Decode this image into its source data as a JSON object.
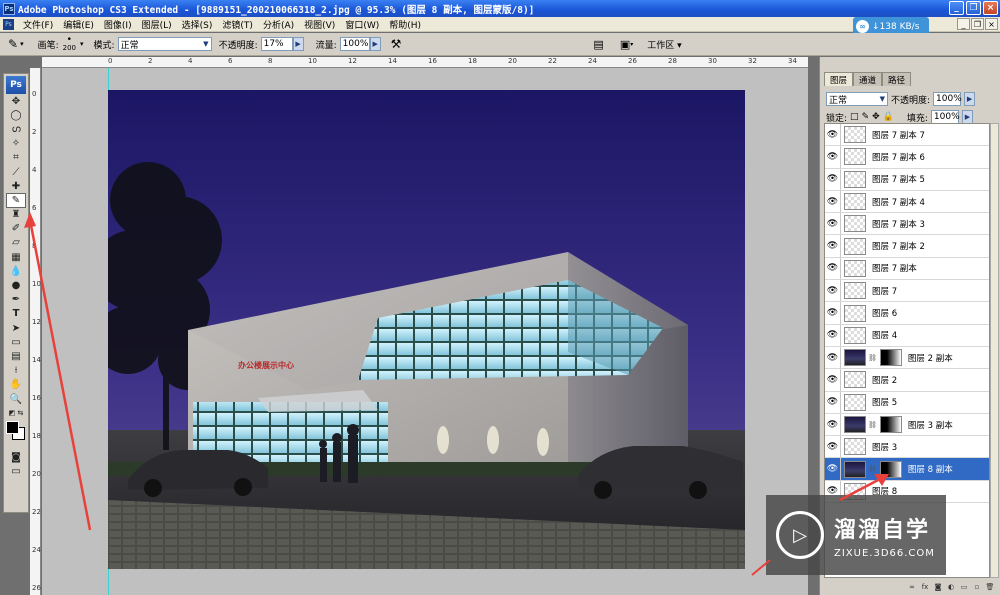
{
  "window": {
    "title": "Adobe Photoshop CS3 Extended - [9889151_200210066318_2.jpg @ 95.3% (图层 8 副本, 图层蒙版/8)]"
  },
  "menu": [
    "文件(F)",
    "编辑(E)",
    "图像(I)",
    "图层(L)",
    "选择(S)",
    "滤镜(T)",
    "分析(A)",
    "视图(V)",
    "窗口(W)",
    "帮助(H)"
  ],
  "speed_badge": "↓138 KB/s",
  "options": {
    "brush_label": "画笔:",
    "brush_size": "200",
    "mode_label": "模式:",
    "mode_value": "正常",
    "opacity_label": "不透明度:",
    "opacity_value": "17%",
    "flow_label": "流量:",
    "flow_value": "100%",
    "workspace_label": "工作区 ▾"
  },
  "ruler_h": [
    "0",
    "2",
    "4",
    "6",
    "8",
    "10",
    "12",
    "14",
    "16",
    "18",
    "20",
    "22",
    "24",
    "26",
    "28",
    "30",
    "32",
    "34",
    "36"
  ],
  "ruler_v": [
    "0",
    "2",
    "4",
    "6",
    "8",
    "10",
    "12",
    "14",
    "16",
    "18",
    "20",
    "22",
    "24",
    "26"
  ],
  "panel": {
    "tabs": [
      "图层",
      "通道",
      "路径"
    ],
    "blend_mode": "正常",
    "opacity_label": "不透明度:",
    "opacity_value": "100%",
    "lock_label": "锁定:",
    "fill_label": "填充:",
    "fill_value": "100%"
  },
  "layers": [
    {
      "name": "图层 7 副本 7",
      "mask": false,
      "selected": false
    },
    {
      "name": "图层 7 副本 6",
      "mask": false,
      "selected": false
    },
    {
      "name": "图层 7 副本 5",
      "mask": false,
      "selected": false
    },
    {
      "name": "图层 7 副本 4",
      "mask": false,
      "selected": false
    },
    {
      "name": "图层 7 副本 3",
      "mask": false,
      "selected": false
    },
    {
      "name": "图层 7 副本 2",
      "mask": false,
      "selected": false
    },
    {
      "name": "图层 7 副本",
      "mask": false,
      "selected": false
    },
    {
      "name": "图层 7",
      "mask": false,
      "selected": false
    },
    {
      "name": "图层 6",
      "mask": false,
      "selected": false
    },
    {
      "name": "图层 4",
      "mask": false,
      "selected": false
    },
    {
      "name": "图层 2 副本",
      "mask": true,
      "selected": false
    },
    {
      "name": "图层 2",
      "mask": false,
      "selected": false
    },
    {
      "name": "图层 5",
      "mask": false,
      "selected": false
    },
    {
      "name": "图层 3 副本",
      "mask": true,
      "selected": false
    },
    {
      "name": "图层 3",
      "mask": false,
      "selected": false
    },
    {
      "name": "图层 8 副本",
      "mask": true,
      "selected": true
    },
    {
      "name": "图层 8",
      "mask": false,
      "selected": false
    }
  ],
  "building_sign": "办公楼展示中心",
  "watermark": {
    "title": "溜溜自学",
    "url": "ZIXUE.3D66.COM"
  }
}
